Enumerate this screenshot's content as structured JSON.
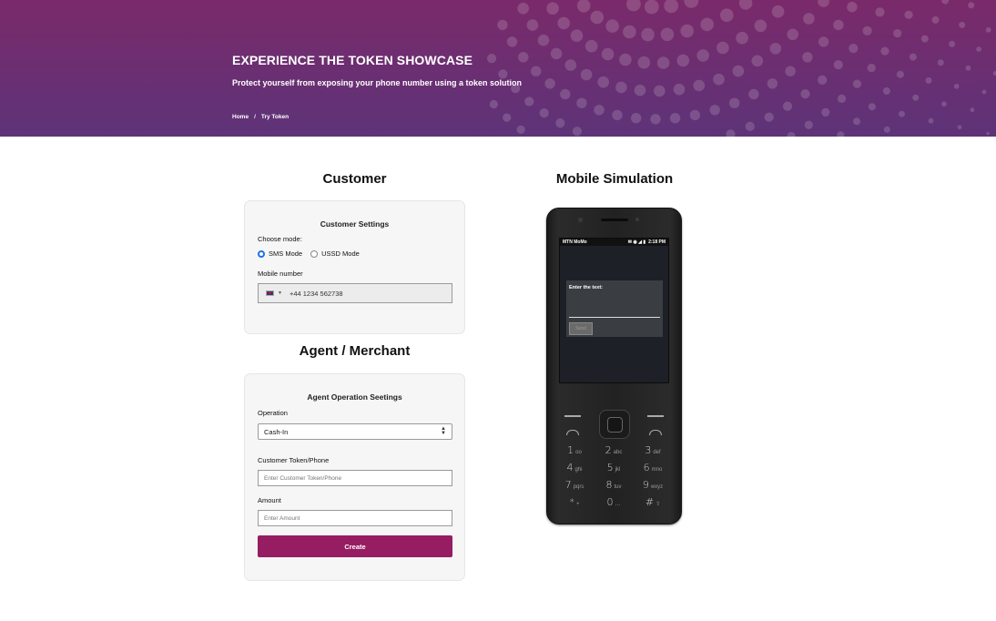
{
  "hero": {
    "title": "EXPERIENCE THE TOKEN SHOWCASE",
    "subtitle": "Protect yourself from exposing your phone number using a token solution",
    "breadcrumb": {
      "home": "Home",
      "separator": "/",
      "current": "Try Token"
    }
  },
  "customer": {
    "heading": "Customer",
    "card_title": "Customer Settings",
    "mode_label": "Choose mode:",
    "modes": [
      {
        "label": "SMS Mode",
        "selected": true
      },
      {
        "label": "USSD Mode",
        "selected": false
      }
    ],
    "mobile_label": "Mobile number",
    "mobile_value": "+44 1234 562738",
    "flag_icon": "uk-flag-icon"
  },
  "merchant": {
    "heading": "Agent / Merchant",
    "card_title": "Agent Operation Seetings",
    "operation_label": "Operation",
    "operation_value": "Cash-In",
    "token_label": "Customer Token/Phone",
    "token_placeholder": "Enter Customer Token/Phone",
    "amount_label": "Amount",
    "amount_placeholder": "Enter Amount",
    "create_label": "Create",
    "button_color": "#961d62"
  },
  "simulation": {
    "heading": "Mobile Simulation",
    "status_left": "MTN MoMo",
    "status_icons": "✉ ◉ ◢ ▮",
    "status_time": "2:18 PM",
    "dialog_label": "Enter the text:",
    "dialog_button": "Send",
    "keys": [
      {
        "d": "1",
        "s": "oo"
      },
      {
        "d": "2",
        "s": "abc"
      },
      {
        "d": "3",
        "s": "def"
      },
      {
        "d": "4",
        "s": "ghi"
      },
      {
        "d": "5",
        "s": "jkl"
      },
      {
        "d": "6",
        "s": "mno"
      },
      {
        "d": "7",
        "s": "pqrs"
      },
      {
        "d": "8",
        "s": "tuv"
      },
      {
        "d": "9",
        "s": "wxyz"
      },
      {
        "d": "*",
        "s": "+"
      },
      {
        "d": "0",
        "s": "…"
      },
      {
        "d": "#",
        "s": "⇧"
      }
    ]
  },
  "colors": {
    "hero_start": "#7a2a6a",
    "hero_end": "#5e3378",
    "radio_selected": "#1a73e8"
  }
}
